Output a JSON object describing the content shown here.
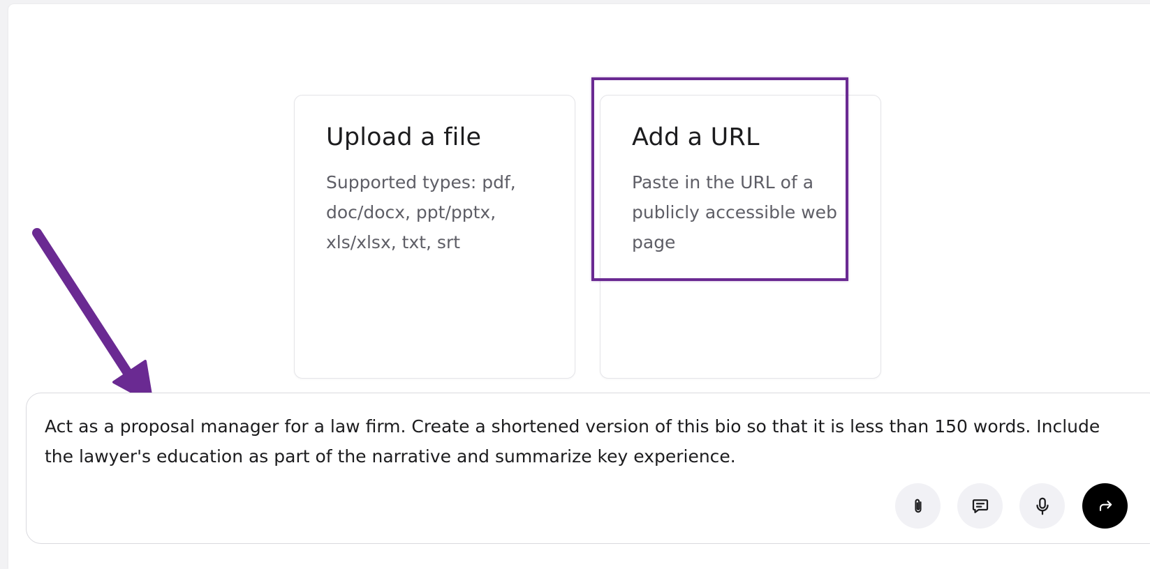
{
  "cards": [
    {
      "title": "Upload a file",
      "description": "Supported types: pdf, doc/docx, ppt/pptx, xls/xlsx, txt, srt"
    },
    {
      "title": "Add a URL",
      "description": "Paste in the URL of a publicly accessible web page"
    }
  ],
  "prompt": {
    "text": "Act as a proposal manager for a law firm. Create a shortened version of this bio so that it is less than 150 words. Include the lawyer's education as part of the narrative and summarize key experience."
  },
  "input_actions": [
    {
      "icon": "paperclip-icon"
    },
    {
      "icon": "chat-bubble-icon"
    },
    {
      "icon": "microphone-icon"
    },
    {
      "icon": "send-arrow-icon"
    }
  ],
  "annotation": {
    "color": "#6a2a92"
  }
}
